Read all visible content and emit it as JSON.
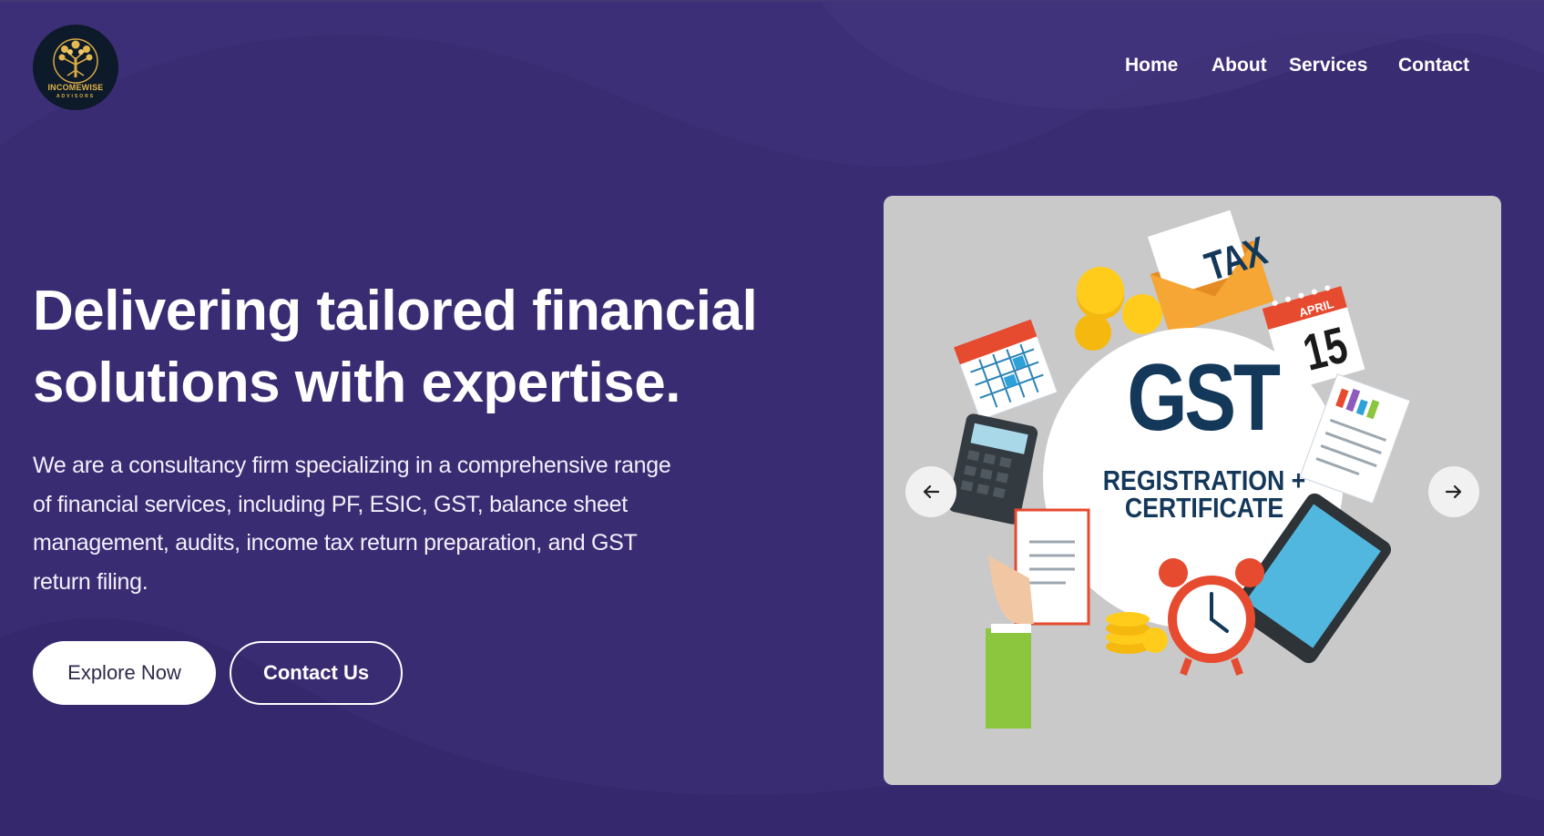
{
  "brand": {
    "name_line1": "INCOMEWISE",
    "name_line2": "ADVISORS"
  },
  "nav": {
    "items": [
      {
        "label": "Home"
      },
      {
        "label": "About"
      },
      {
        "label": "Services"
      },
      {
        "label": "Contact"
      }
    ]
  },
  "hero": {
    "headline": "Delivering tailored financial solutions with expertise.",
    "description": "We are a consultancy firm specializing in a comprehensive range of financial services, including PF, ESIC, GST, balance sheet management, audits, income tax return preparation, and GST return filing.",
    "primary_button": "Explore Now",
    "secondary_button": "Contact Us"
  },
  "carousel": {
    "slide": {
      "title": "GST",
      "subtitle_line1": "REGISTRATION +",
      "subtitle_line2": "CERTIFICATE",
      "tax_tag": "TAX",
      "calendar_month": "APRIL",
      "calendar_day": "15"
    },
    "prev_icon": "arrow-left-icon",
    "next_icon": "arrow-right-icon"
  },
  "colors": {
    "background": "#3a2c72",
    "text": "#ffffff",
    "button_text_dark": "#2f2a4a",
    "carousel_bg": "#c9c9c9",
    "gst_navy": "#14385a"
  }
}
